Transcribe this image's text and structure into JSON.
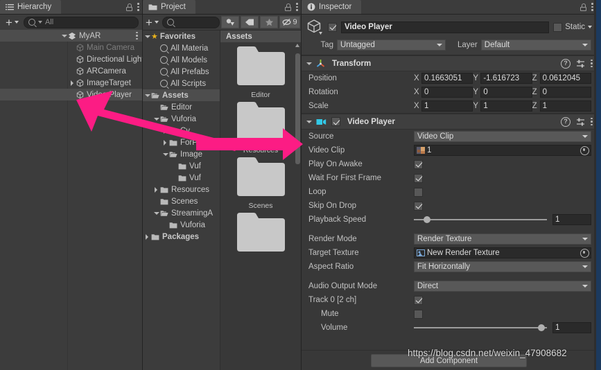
{
  "hierarchy": {
    "tab_label": "Hierarchy",
    "tab_icon": "hierarchy-list-icon",
    "search_placeholder": "All",
    "items": [
      {
        "label": "MyAR",
        "icon": "unity-scene-icon",
        "depth": 0,
        "expanded": true,
        "selected": true,
        "dim": false
      },
      {
        "label": "Main Camera",
        "icon": "gameobject-cube-icon",
        "depth": 1,
        "expanded": null,
        "selected": false,
        "dim": true
      },
      {
        "label": "Directional Light",
        "icon": "gameobject-cube-icon",
        "depth": 1,
        "expanded": null,
        "selected": false,
        "dim": false
      },
      {
        "label": "ARCamera",
        "icon": "gameobject-cube-icon",
        "depth": 1,
        "expanded": null,
        "selected": false,
        "dim": false
      },
      {
        "label": "ImageTarget",
        "icon": "gameobject-cube-icon",
        "depth": 1,
        "expanded": false,
        "selected": false,
        "dim": false
      },
      {
        "label": "Video Player",
        "icon": "gameobject-cube-icon",
        "depth": 1,
        "expanded": null,
        "selected": true,
        "dim": false
      }
    ]
  },
  "project": {
    "tab_label": "Project",
    "tab_icon": "folder-icon",
    "search_placeholder": "",
    "toolbar_buttons": [
      {
        "name": "asset-type-filter-icon",
        "label": ""
      },
      {
        "name": "label-filter-icon",
        "label": ""
      },
      {
        "name": "favorite-star-icon",
        "label": ""
      },
      {
        "name": "hidden-packages-icon",
        "label": "9"
      }
    ],
    "tree": [
      {
        "label": "Favorites",
        "icon": "star-icon",
        "depth": 0,
        "expanded": true,
        "bold": true,
        "selected": false
      },
      {
        "label": "All Materia",
        "icon": "search-icon",
        "depth": 1,
        "expanded": null,
        "bold": false,
        "selected": false
      },
      {
        "label": "All Models",
        "icon": "search-icon",
        "depth": 1,
        "expanded": null,
        "bold": false,
        "selected": false
      },
      {
        "label": "All Prefabs",
        "icon": "search-icon",
        "depth": 1,
        "expanded": null,
        "bold": false,
        "selected": false
      },
      {
        "label": "All Scripts",
        "icon": "search-icon",
        "depth": 1,
        "expanded": null,
        "bold": false,
        "selected": false
      },
      {
        "label": "Assets",
        "icon": "folder-open-icon",
        "depth": 0,
        "expanded": true,
        "bold": true,
        "selected": true
      },
      {
        "label": "Editor",
        "icon": "folder-open-icon",
        "depth": 1,
        "expanded": null,
        "bold": false,
        "selected": false
      },
      {
        "label": "Vuforia",
        "icon": "folder-open-icon",
        "depth": 1,
        "expanded": true,
        "bold": false,
        "selected": false
      },
      {
        "label": "Cy",
        "icon": "folder-icon",
        "depth": 2,
        "expanded": false,
        "bold": false,
        "selected": false
      },
      {
        "label": "ForPri",
        "icon": "folder-icon",
        "depth": 2,
        "expanded": false,
        "bold": false,
        "selected": false
      },
      {
        "label": "Image",
        "icon": "folder-open-icon",
        "depth": 2,
        "expanded": true,
        "bold": false,
        "selected": false
      },
      {
        "label": "Vuf",
        "icon": "folder-icon",
        "depth": 3,
        "expanded": null,
        "bold": false,
        "selected": false
      },
      {
        "label": "Vuf",
        "icon": "folder-icon",
        "depth": 3,
        "expanded": null,
        "bold": false,
        "selected": false
      },
      {
        "label": "Resources",
        "icon": "folder-icon",
        "depth": 1,
        "expanded": false,
        "bold": false,
        "selected": false
      },
      {
        "label": "Scenes",
        "icon": "folder-icon",
        "depth": 1,
        "expanded": null,
        "bold": false,
        "selected": false
      },
      {
        "label": "StreamingA",
        "icon": "folder-open-icon",
        "depth": 1,
        "expanded": true,
        "bold": false,
        "selected": false
      },
      {
        "label": "Vuforia",
        "icon": "folder-icon",
        "depth": 2,
        "expanded": null,
        "bold": false,
        "selected": false
      },
      {
        "label": "Packages",
        "icon": "folder-icon",
        "depth": 0,
        "expanded": false,
        "bold": true,
        "selected": false
      }
    ],
    "grid_header": "Assets",
    "grid_items": [
      {
        "label": "Editor",
        "icon": "folder-icon"
      },
      {
        "label": "Resources",
        "icon": "folder-icon"
      },
      {
        "label": "Scenes",
        "icon": "folder-icon"
      },
      {
        "label": "",
        "icon": "folder-icon"
      }
    ]
  },
  "inspector": {
    "tab_label": "Inspector",
    "tab_icon": "info-icon",
    "object": {
      "enabled": true,
      "name": "Video Player",
      "static_label": "Static",
      "static_checked": false,
      "tag_label": "Tag",
      "tag_value": "Untagged",
      "layer_label": "Layer",
      "layer_value": "Default"
    },
    "transform": {
      "title": "Transform",
      "icon": "transform-axis-icon",
      "expanded": true,
      "rows": [
        {
          "label": "Position",
          "x": "0.1663051",
          "y": "-1.616723",
          "z": "0.0612045"
        },
        {
          "label": "Rotation",
          "x": "0",
          "y": "0",
          "z": "0"
        },
        {
          "label": "Scale",
          "x": "1",
          "y": "1",
          "z": "1"
        }
      ],
      "axes": [
        "X",
        "Y",
        "Z"
      ]
    },
    "video_player": {
      "title": "Video Player",
      "icon": "video-player-icon",
      "enabled": true,
      "expanded": true,
      "fields": [
        {
          "type": "dropdown",
          "label": "Source",
          "value": "Video Clip"
        },
        {
          "type": "object",
          "label": "Video Clip",
          "value": "1",
          "icon": "video-clip-thumbnail-icon"
        },
        {
          "type": "checkbox",
          "label": "Play On Awake",
          "checked": true
        },
        {
          "type": "checkbox",
          "label": "Wait For First Frame",
          "checked": true
        },
        {
          "type": "checkbox",
          "label": "Loop",
          "checked": false
        },
        {
          "type": "checkbox",
          "label": "Skip On Drop",
          "checked": true
        },
        {
          "type": "slider",
          "label": "Playback Speed",
          "value": "1",
          "knob_pct": 10
        },
        {
          "type": "spacer"
        },
        {
          "type": "dropdown",
          "label": "Render Mode",
          "value": "Render Texture"
        },
        {
          "type": "object",
          "label": "Target Texture",
          "value": "New Render Texture",
          "icon": "render-texture-icon"
        },
        {
          "type": "dropdown",
          "label": "Aspect Ratio",
          "value": "Fit Horizontally"
        },
        {
          "type": "spacer"
        },
        {
          "type": "dropdown",
          "label": "Audio Output Mode",
          "value": "Direct"
        },
        {
          "type": "checkbox",
          "label": "Track 0 [2 ch]",
          "checked": true
        },
        {
          "type": "checkbox",
          "label": "Mute",
          "checked": false,
          "indent": true
        },
        {
          "type": "slider",
          "label": "Volume",
          "value": "1",
          "knob_pct": 96,
          "indent": true
        }
      ]
    },
    "add_component_label": "Add Component"
  },
  "annotations": {
    "arrow_color": "#fc1c84",
    "arrows": [
      {
        "name": "arrow-to-video-player",
        "from": [
          345,
          205
        ],
        "to": [
          118,
          147
        ]
      },
      {
        "name": "arrow-to-assets-grid",
        "from": [
          283,
          208
        ],
        "to": [
          433,
          208
        ]
      }
    ]
  },
  "watermark": {
    "text": "https://blog.csdn.net/weixin_47908682"
  },
  "colors": {
    "panel_bg": "#383838",
    "panel_header": "#3c3c3c",
    "tab_active": "#4b4b4b",
    "selection": "#4d4d4d",
    "field_bg": "#2a2a2a",
    "button_bg": "#585858",
    "text": "#c4c4c4",
    "accent_pink": "#fc1c84",
    "video_icon_cyan": "#32c8e6",
    "star_gold": "#e8b21b",
    "right_strip_blue": "#1c3a5e"
  }
}
